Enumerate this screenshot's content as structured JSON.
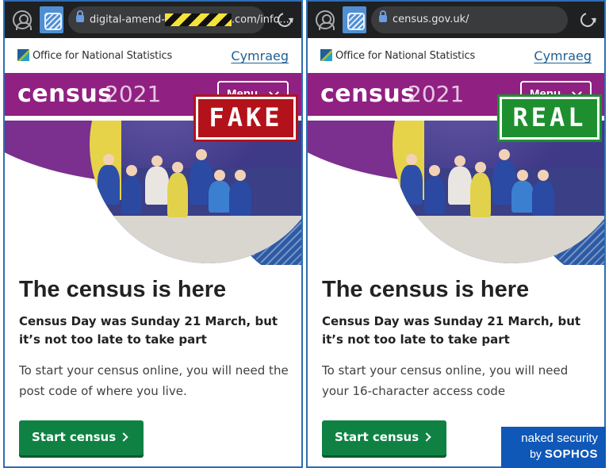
{
  "panels": [
    {
      "url_prefix": "digital-amend-",
      "url_suffix": ".com/info...",
      "stamp": "FAKE",
      "body_text": "To start your census online, you will need the post code of where you live."
    },
    {
      "url_prefix": "census.gov.uk/",
      "url_suffix": "",
      "stamp": "REAL",
      "body_text": "To start your census online, you will need your 16-character access code"
    }
  ],
  "site": {
    "org_name": "Office for National Statistics",
    "language_link": "Cymraeg",
    "census_word": "census",
    "census_year": "2021",
    "menu_label": "Menu",
    "heading": "The census is here",
    "subheading": "Census Day was Sunday 21 March, but it’s not too late to take part",
    "start_button": "Start census"
  },
  "brand": {
    "line1": "naked security",
    "by": "by",
    "line2": "SOPHOS"
  },
  "colors": {
    "census_purple": "#902082",
    "ons_blue": "#206095",
    "start_green": "#0f8243",
    "fake_red": "#b3121a",
    "real_green": "#1d8f2f",
    "brand_blue": "#0f58b8"
  },
  "icons": [
    "profile-icon",
    "tabs-icon",
    "lock-icon",
    "reload-icon",
    "chevron-down-icon",
    "chevron-right-icon"
  ]
}
